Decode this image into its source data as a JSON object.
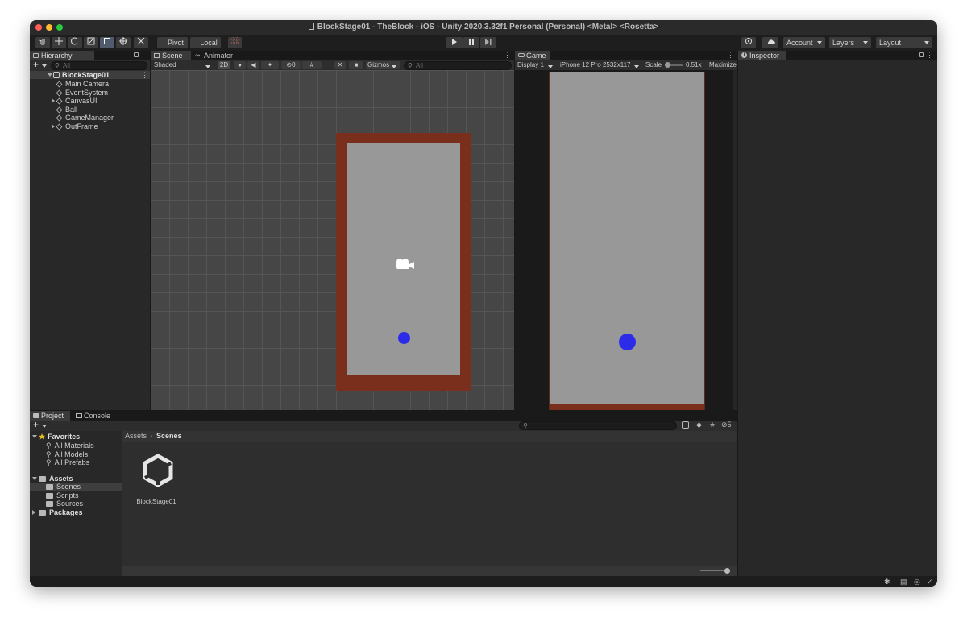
{
  "window": {
    "title": "BlockStage01 - TheBlock - iOS - Unity 2020.3.32f1 Personal (Personal) <Metal> <Rosetta>",
    "traffic_colors": [
      "#ff5f57",
      "#febc2e",
      "#28c840"
    ]
  },
  "toolbar": {
    "tools": [
      "hand-icon",
      "move-icon",
      "rotate-icon",
      "scale-icon",
      "rect-tool-icon",
      "transform-icon",
      "custom-tool-icon"
    ],
    "pivot_label": "Pivot",
    "local_label": "Local",
    "account_label": "Account",
    "layers_label": "Layers",
    "layout_label": "Layout"
  },
  "hierarchy": {
    "tab_label": "Hierarchy",
    "search_placeholder": "All",
    "scene_name": "BlockStage01",
    "items": [
      {
        "label": "Main Camera",
        "expandable": false
      },
      {
        "label": "EventSystem",
        "expandable": false
      },
      {
        "label": "CanvasUI",
        "expandable": true
      },
      {
        "label": "Ball",
        "expandable": false
      },
      {
        "label": "GameManager",
        "expandable": false
      },
      {
        "label": "OutFrame",
        "expandable": true
      }
    ]
  },
  "scene_view": {
    "tab_scene": "Scene",
    "tab_animator": "Animator",
    "shading_mode": "Shaded",
    "mode_2d": "2D",
    "hidden_count": "0",
    "gizmos_label": "Gizmos",
    "search_placeholder": "All",
    "frame_color": "#7a2e1c",
    "field_color": "#989898",
    "ball_color": "#2c2ce8",
    "grid_bg": "#464646"
  },
  "game_view": {
    "tab_label": "Game",
    "display": "Display 1",
    "device": "iPhone 12 Pro",
    "resolution": "2532x117",
    "scale_label": "Scale",
    "scale_value": "0.51x",
    "maximize_label": "Maximize"
  },
  "inspector": {
    "tab_label": "Inspector"
  },
  "project": {
    "tab_project": "Project",
    "tab_console": "Console",
    "hidden_count": "5",
    "favorites_label": "Favorites",
    "favorites": [
      "All Materials",
      "All Models",
      "All Prefabs"
    ],
    "assets_label": "Assets",
    "asset_folders": [
      "Scenes",
      "Scripts",
      "Sources"
    ],
    "packages_label": "Packages",
    "breadcrumb_root": "Assets",
    "breadcrumb_current": "Scenes",
    "files": [
      "BlockStage01"
    ]
  }
}
